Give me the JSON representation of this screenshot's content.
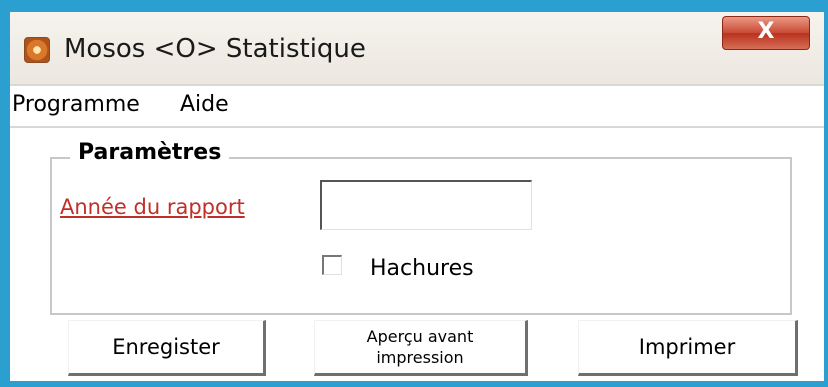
{
  "window": {
    "title": "Mosos <O> Statistique",
    "close_glyph": "X",
    "border_color": "#2a9fd0"
  },
  "menu": {
    "items": [
      {
        "label": "Programme"
      },
      {
        "label": "Aide"
      }
    ]
  },
  "params": {
    "group_label": "Paramètres",
    "year_label": "Année du rapport",
    "year_value": "",
    "hatch_label": "Hachures",
    "hatch_checked": false
  },
  "buttons": {
    "save_label": "Enregister",
    "preview_line1": "Aperçu avant",
    "preview_line2": "impression",
    "print_label": "Imprimer"
  },
  "icons": {
    "app": "app-logo-icon",
    "close": "close-icon"
  }
}
